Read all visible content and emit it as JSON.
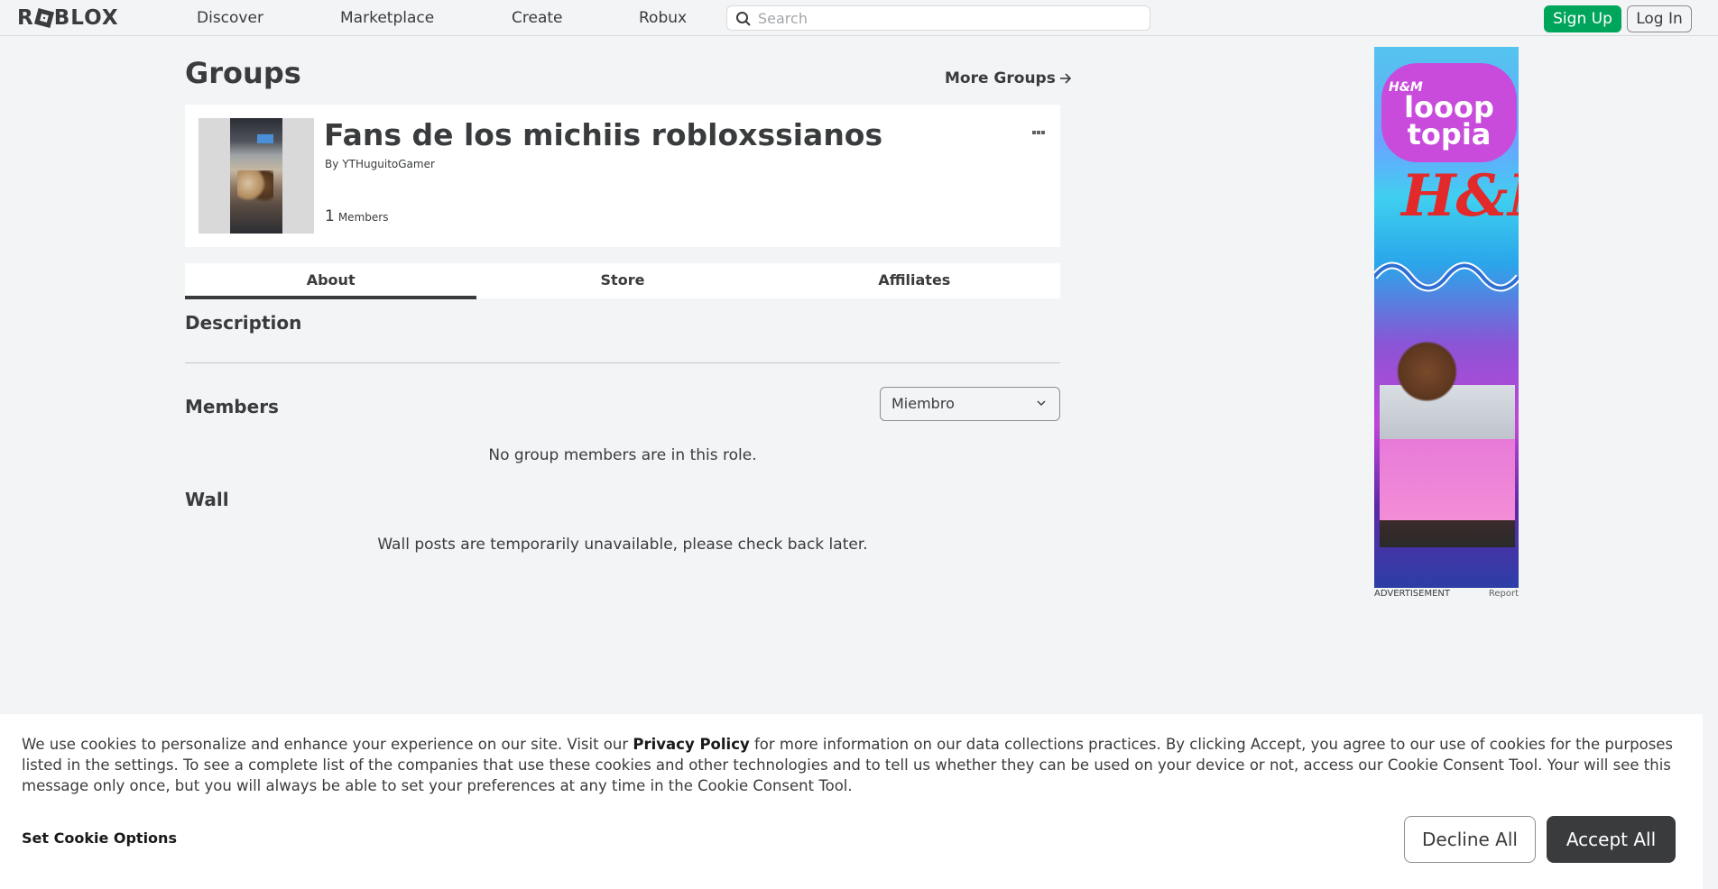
{
  "nav": {
    "logo": "ROBLOX",
    "links": [
      "Discover",
      "Marketplace",
      "Create",
      "Robux"
    ],
    "search_placeholder": "Search",
    "signup_label": "Sign Up",
    "login_label": "Log In"
  },
  "page": {
    "title": "Groups",
    "more_groups": "More Groups"
  },
  "group": {
    "name": "Fans de los michiis robloxssianos",
    "by_label": "By",
    "owner": "YTHuguitoGamer",
    "member_count": "1",
    "members_label": "Members"
  },
  "tabs": [
    "About",
    "Store",
    "Affiliates"
  ],
  "about": {
    "description_title": "Description",
    "members_title": "Members",
    "role_selected": "Miembro",
    "no_members_text": "No group members are in this role.",
    "wall_title": "Wall",
    "wall_text": "Wall posts are temporarily unavailable, please check back later."
  },
  "ad": {
    "brand_top": "H&M",
    "headline": "looop topia",
    "brand_main": "H&M",
    "label": "ADVERTISEMENT",
    "report": "Report"
  },
  "cookie": {
    "text_before": "We use cookies to personalize and enhance your experience on our site. Visit our ",
    "policy_link": "Privacy Policy",
    "text_after": " for more information on our data collections practices. By clicking Accept, you agree to our use of cookies for the purposes listed in the settings. To see a complete list of the companies that use these cookies and other technologies and to tell us whether they can be used on your device or not, access our Cookie Consent Tool. Your will see this message only once, but you will always be able to set your preferences at any time in the Cookie Consent Tool.",
    "options_label": "Set Cookie Options",
    "decline_label": "Decline All",
    "accept_label": "Accept All"
  },
  "colors": {
    "signup_green": "#00a55c",
    "text_dark": "#393b3d",
    "background": "#f2f4f5",
    "accept_button": "#393b3d"
  }
}
